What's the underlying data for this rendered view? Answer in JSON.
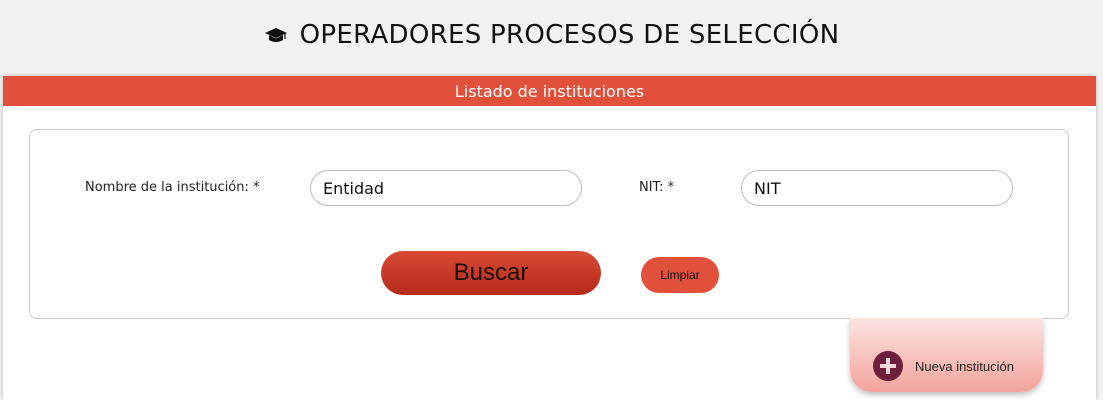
{
  "header": {
    "title": "OPERADORES PROCESOS DE SELECCIÓN",
    "icon": "graduation-cap-icon"
  },
  "panel": {
    "title": "Listado de instituciones",
    "accent_color": "#e0503a"
  },
  "form": {
    "name_label": "Nombre de la institución: *",
    "name_value": "Entidad",
    "nit_label": "NIT: *",
    "nit_value": "NIT"
  },
  "actions": {
    "search_label": "Buscar",
    "clear_label": "Limpiar",
    "new_label": "Nueva institución",
    "new_icon": "plus-circle-icon"
  }
}
